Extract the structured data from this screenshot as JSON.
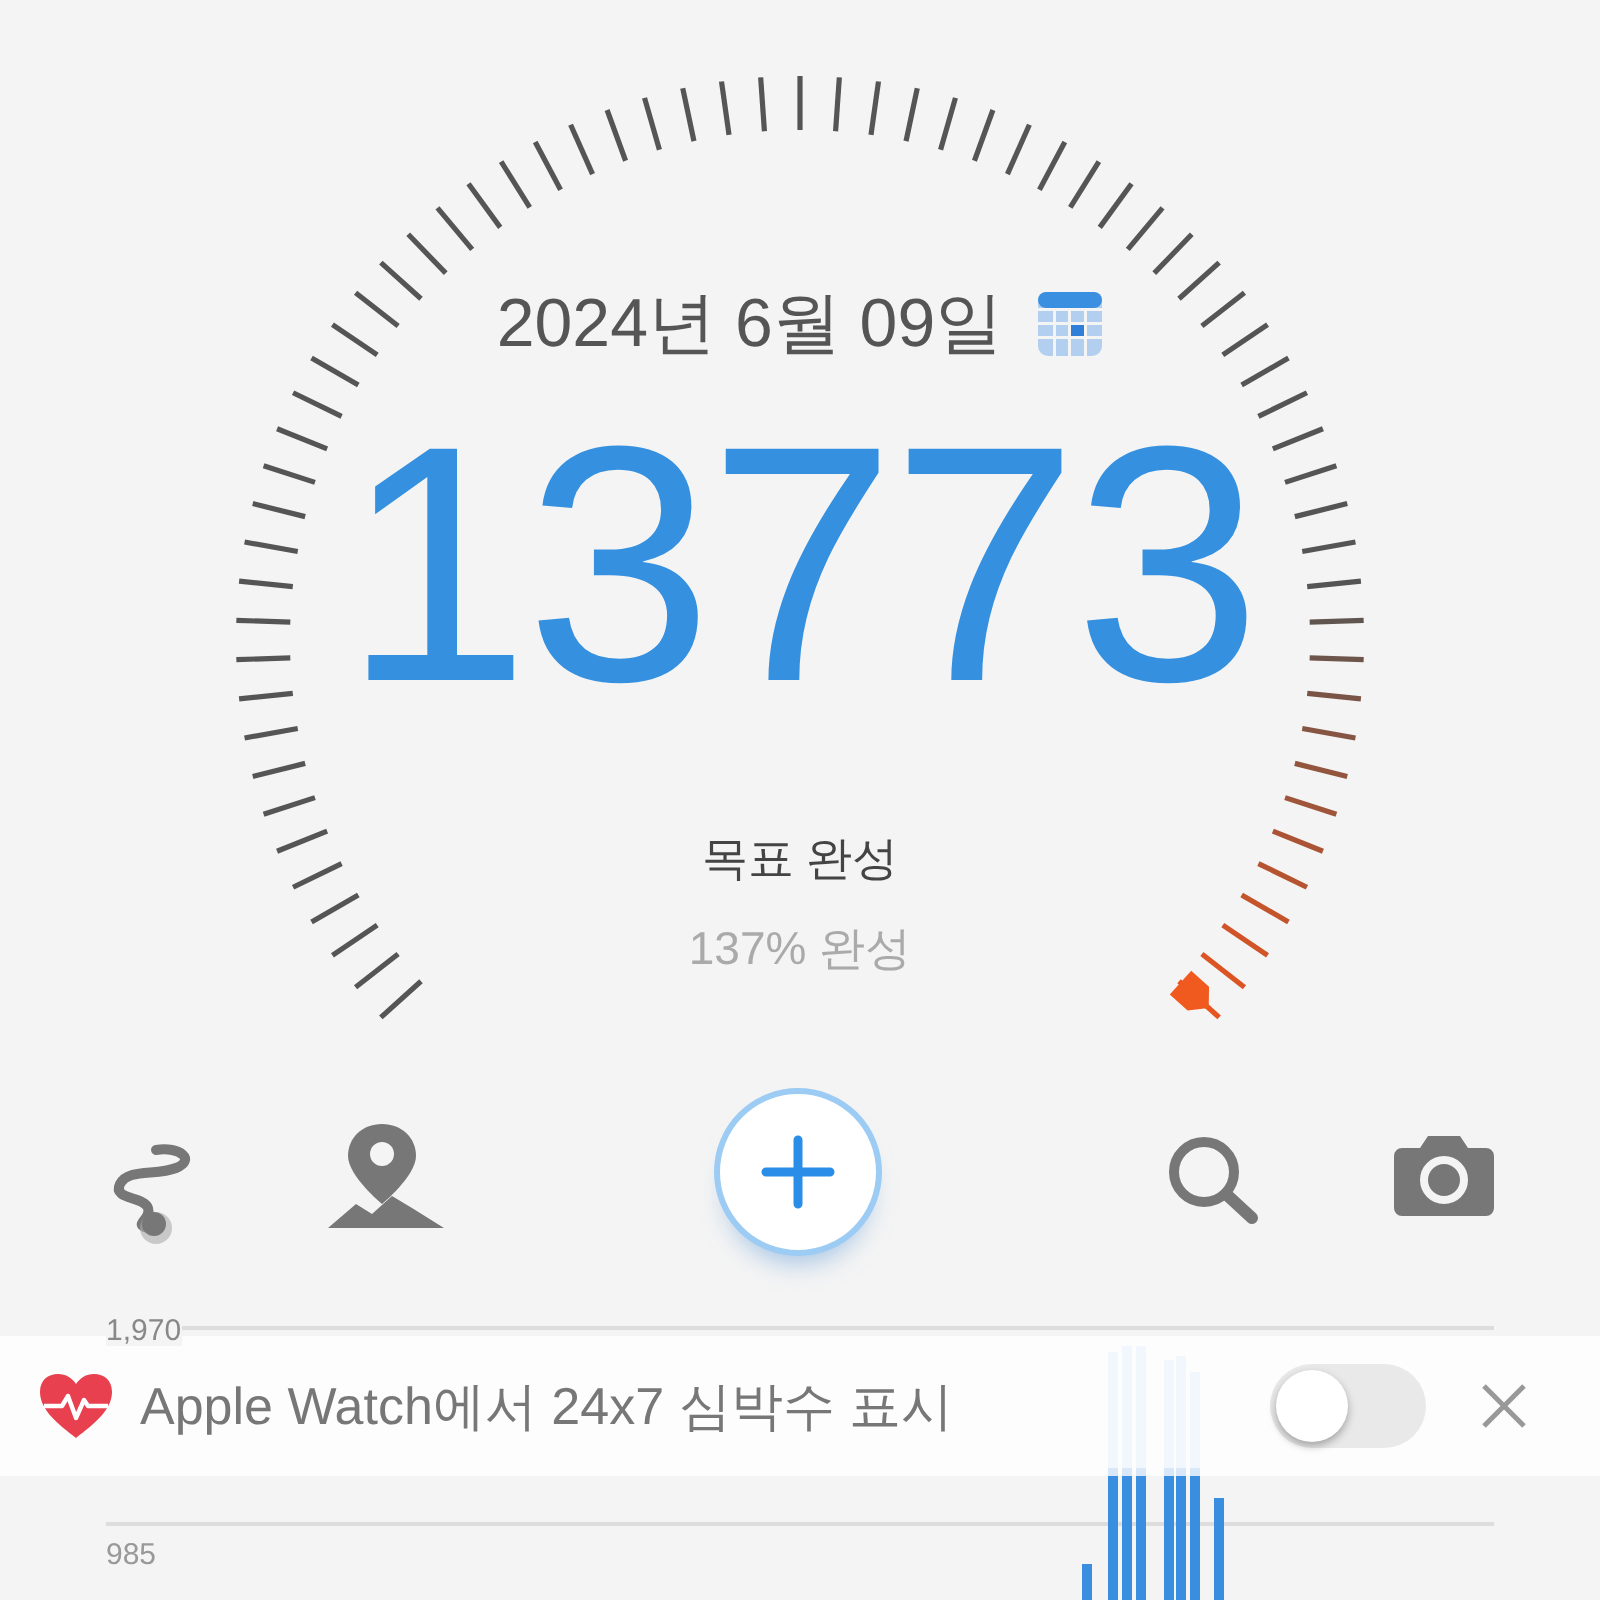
{
  "date": "2024년 6월 09일",
  "steps": "13773",
  "goal_status": "목표 완성",
  "percent": "137% 완성",
  "chart": {
    "gridlines": [
      {
        "label": "1,970"
      },
      {
        "label": "985"
      }
    ]
  },
  "banner": {
    "text": "Apple Watch에서 24x7 심박수 표시",
    "toggle_on": false
  }
}
